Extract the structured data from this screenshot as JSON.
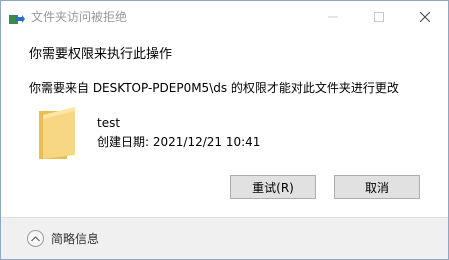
{
  "window": {
    "title": "文件夹访问被拒绝",
    "controls": {
      "minimize": "minimize-icon",
      "maximize": "maximize-icon",
      "close": "close-icon"
    }
  },
  "dialog": {
    "heading": "你需要权限来执行此操作",
    "message": "你需要来自 DESKTOP-PDEP0M5\\ds 的权限才能对此文件夹进行更改",
    "item": {
      "icon": "folder-icon",
      "name": "test",
      "created": "创建日期: 2021/12/21 10:41"
    },
    "buttons": {
      "retry": "重试(R)",
      "cancel": "取消"
    },
    "details_toggle": "简略信息"
  },
  "colors": {
    "folder": "#f3d27a",
    "button_bg": "#e1e1e1",
    "footer_bg": "#f0f0f0"
  }
}
